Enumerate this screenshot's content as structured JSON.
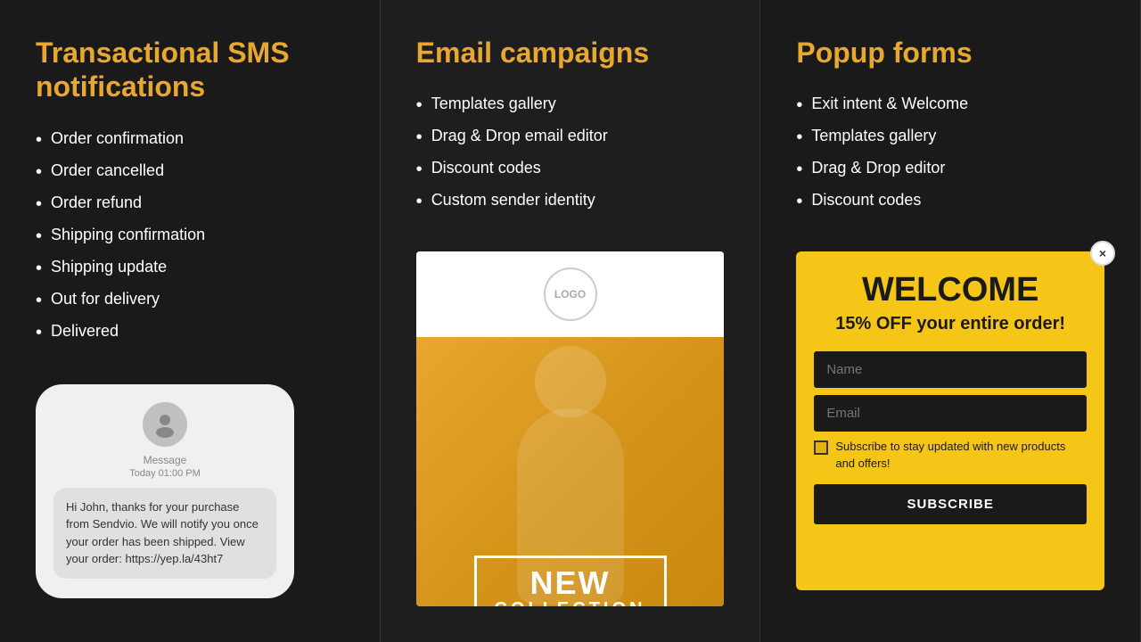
{
  "sms": {
    "title": "Transactional SMS notifications",
    "items": [
      "Order confirmation",
      "Order cancelled",
      "Order refund",
      "Shipping confirmation",
      "Shipping update",
      "Out for delivery",
      "Delivered"
    ],
    "phone": {
      "sender_label": "Message",
      "timestamp": "Today 01:00 PM",
      "message": "Hi John, thanks for your purchase from Sendvio. We will notify you once your order has been shipped. View your order: https://yep.la/43ht7"
    }
  },
  "email": {
    "title": "Email campaigns",
    "items": [
      "Templates gallery",
      "Drag & Drop email editor",
      "Discount codes",
      "Custom sender identity"
    ],
    "preview": {
      "logo_text": "LOGO",
      "new_collection": "NEW",
      "collection_sub": "COLLECTION"
    }
  },
  "popup": {
    "title": "Popup forms",
    "items": [
      "Exit intent & Welcome",
      "Templates gallery",
      "Drag & Drop editor",
      "Discount codes"
    ],
    "form": {
      "close_icon": "×",
      "welcome": "WELCOME",
      "offer": "15% OFF your entire order!",
      "name_placeholder": "Name",
      "email_placeholder": "Email",
      "checkbox_text": "Subscribe to stay updated with new products and offers!",
      "subscribe_label": "SUBSCRIBE"
    }
  }
}
